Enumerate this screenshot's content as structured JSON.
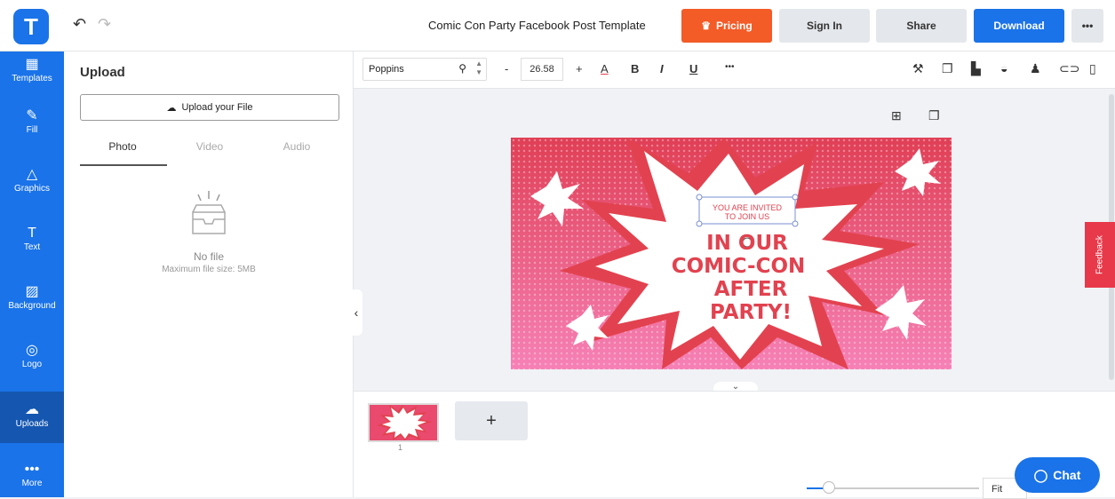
{
  "app": {
    "logo_letter": "T",
    "title": "Comic Con Party Facebook Post Template"
  },
  "header": {
    "pricing": "Pricing",
    "sign_in": "Sign In",
    "share": "Share",
    "download": "Download",
    "more": "•••"
  },
  "sidebar": {
    "items": [
      {
        "label": "Templates",
        "icon": "templates-icon"
      },
      {
        "label": "Fill",
        "icon": "brush-icon"
      },
      {
        "label": "Graphics",
        "icon": "shapes-icon"
      },
      {
        "label": "Text",
        "icon": "text-icon"
      },
      {
        "label": "Background",
        "icon": "background-icon"
      },
      {
        "label": "Logo",
        "icon": "logo-icon"
      },
      {
        "label": "Uploads",
        "icon": "upload-cloud-icon"
      },
      {
        "label": "More",
        "icon": "more-icon"
      }
    ]
  },
  "panel": {
    "title": "Upload",
    "upload_button": "Upload your File",
    "tabs": [
      "Photo",
      "Video",
      "Audio"
    ],
    "empty_title": "No file",
    "empty_subtitle": "Maximum file size: 5MB"
  },
  "toolbar": {
    "font": "Poppins",
    "font_size": "26.58",
    "minus": "-",
    "plus": "+",
    "bold": "B",
    "italic": "I",
    "underline": "U",
    "more": "•••"
  },
  "design": {
    "invite_line1": "YOU ARE INVITED",
    "invite_line2": "TO JOIN US",
    "headline_line1": "IN OUR",
    "headline_line2": "COMIC-CON",
    "headline_line3": "AFTER",
    "headline_line4": "PARTY!"
  },
  "pages": {
    "add": "+",
    "current": "1"
  },
  "footer": {
    "fit": "Fit",
    "chat": "Chat",
    "feedback": "Feedback"
  },
  "colors": {
    "primary": "#1a73e8",
    "pricing": "#f35b27",
    "design_red": "#e2424f",
    "design_pink": "#f06a9a",
    "feedback": "#e8394a"
  }
}
